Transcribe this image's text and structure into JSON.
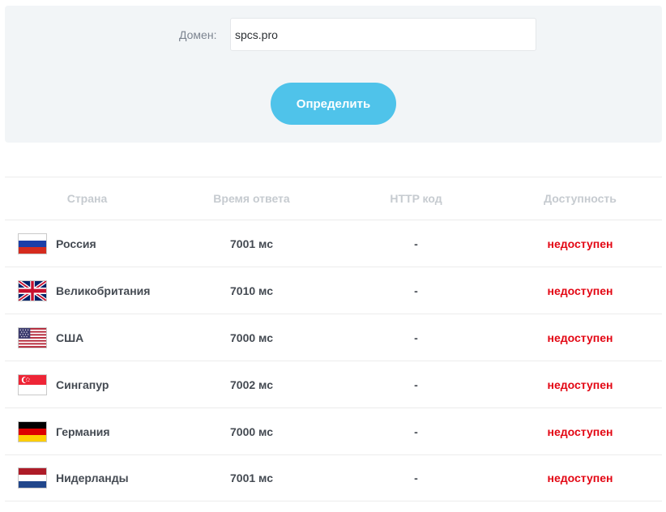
{
  "form": {
    "domain_label": "Домен:",
    "domain_value": "spcs.pro",
    "submit_label": "Определить"
  },
  "table": {
    "headers": {
      "country": "Страна",
      "response_time": "Время ответа",
      "http_code": "HTTP код",
      "availability": "Доступность"
    },
    "rows": [
      {
        "flag_icon": "russia-flag-icon",
        "country": "Россия",
        "response_time": "7001 мс",
        "http_code": "-",
        "availability": "недоступен"
      },
      {
        "flag_icon": "uk-flag-icon",
        "country": "Великобритания",
        "response_time": "7010 мс",
        "http_code": "-",
        "availability": "недоступен"
      },
      {
        "flag_icon": "usa-flag-icon",
        "country": "США",
        "response_time": "7000 мс",
        "http_code": "-",
        "availability": "недоступен"
      },
      {
        "flag_icon": "singapore-flag-icon",
        "country": "Сингапур",
        "response_time": "7002 мс",
        "http_code": "-",
        "availability": "недоступен"
      },
      {
        "flag_icon": "germany-flag-icon",
        "country": "Германия",
        "response_time": "7000 мс",
        "http_code": "-",
        "availability": "недоступен"
      },
      {
        "flag_icon": "netherlands-flag-icon",
        "country": "Нидерланды",
        "response_time": "7001 мс",
        "http_code": "-",
        "availability": "недоступен"
      }
    ]
  },
  "colors": {
    "accent": "#4fc3ea",
    "panel_bg": "#f2f5f7",
    "status_down": "#e30613"
  }
}
